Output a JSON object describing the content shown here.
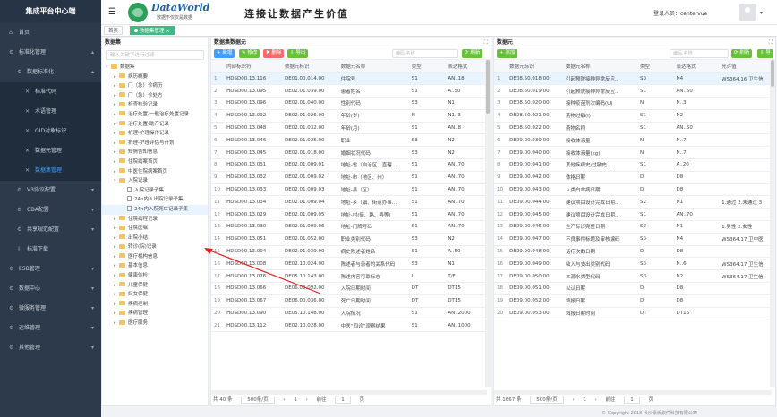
{
  "app": {
    "title": "集成平台中心端",
    "brand": "DataWorld",
    "brand_sub": "数据不仅仅是数据",
    "slogan": "连接让数据产生价值",
    "user_label": "登录人员：centervue"
  },
  "sidebar": {
    "items": [
      {
        "label": "首页",
        "level": 0,
        "icon": "home-icon",
        "arrow": ""
      },
      {
        "label": "标准化管理",
        "level": 0,
        "icon": "gear-icon",
        "arrow": "▴"
      },
      {
        "label": "数据标准化",
        "level": 1,
        "icon": "gear-icon",
        "arrow": "▴"
      },
      {
        "label": "标准代码",
        "level": 2,
        "icon": "wrench-icon",
        "arrow": ""
      },
      {
        "label": "术语管理",
        "level": 2,
        "icon": "wrench-icon",
        "arrow": ""
      },
      {
        "label": "OID对象标识",
        "level": 2,
        "icon": "wrench-icon",
        "arrow": ""
      },
      {
        "label": "数据元管理",
        "level": 2,
        "icon": "wrench-icon",
        "arrow": ""
      },
      {
        "label": "数据集管理",
        "level": 2,
        "icon": "wrench-icon",
        "arrow": "",
        "active": true
      },
      {
        "label": "V3协议配置",
        "level": 1,
        "icon": "gear-icon",
        "arrow": "▾"
      },
      {
        "label": "CDA配置",
        "level": 1,
        "icon": "gear-icon",
        "arrow": "▾"
      },
      {
        "label": "共享规范配置",
        "level": 1,
        "icon": "gear-icon",
        "arrow": "▾"
      },
      {
        "label": "标准下载",
        "level": 1,
        "icon": "download-icon",
        "arrow": ""
      },
      {
        "label": "ESB管理",
        "level": 0,
        "icon": "gear-icon",
        "arrow": "▾"
      },
      {
        "label": "数据中心",
        "level": 0,
        "icon": "gear-icon",
        "arrow": "▾"
      },
      {
        "label": "微服务管理",
        "level": 0,
        "icon": "gear-icon",
        "arrow": "▾"
      },
      {
        "label": "运维管理",
        "level": 0,
        "icon": "gear-icon",
        "arrow": "▾"
      },
      {
        "label": "其他管理",
        "level": 0,
        "icon": "gear-icon",
        "arrow": "▾"
      }
    ]
  },
  "tabs": [
    {
      "label": "首页",
      "active": false
    },
    {
      "label": "数据集管理 ×",
      "active": true
    }
  ],
  "left_panel": {
    "title": "数据集",
    "search_placeholder": "输入关键字进行过滤",
    "tree": [
      {
        "label": "数据集",
        "depth": 0,
        "type": "folder",
        "toggle": "▾"
      },
      {
        "label": "病历概要",
        "depth": 1,
        "type": "folder",
        "toggle": "▸"
      },
      {
        "label": "门（急）诊病历",
        "depth": 1,
        "type": "folder",
        "toggle": "▸"
      },
      {
        "label": "门（急）诊处方",
        "depth": 1,
        "type": "folder",
        "toggle": "▸"
      },
      {
        "label": "检查检验记录",
        "depth": 1,
        "type": "folder",
        "toggle": "▸"
      },
      {
        "label": "治疗处置-一般治疗处置记录",
        "depth": 1,
        "type": "folder",
        "toggle": "▸"
      },
      {
        "label": "治疗处置-助产记录",
        "depth": 1,
        "type": "folder",
        "toggle": "▸"
      },
      {
        "label": "护理-护理操作记录",
        "depth": 1,
        "type": "folder",
        "toggle": "▸"
      },
      {
        "label": "护理-护理评估与计划",
        "depth": 1,
        "type": "folder",
        "toggle": "▸"
      },
      {
        "label": "知情告知信息",
        "depth": 1,
        "type": "folder",
        "toggle": "▸"
      },
      {
        "label": "住院病案首页",
        "depth": 1,
        "type": "folder",
        "toggle": "▸"
      },
      {
        "label": "中医住院病案首页",
        "depth": 1,
        "type": "folder",
        "toggle": "▸"
      },
      {
        "label": "入院记录",
        "depth": 1,
        "type": "folder",
        "toggle": "▾"
      },
      {
        "label": "入院记录子集",
        "depth": 2,
        "type": "file",
        "toggle": ""
      },
      {
        "label": "24h内入出院记录子集",
        "depth": 2,
        "type": "file",
        "toggle": ""
      },
      {
        "label": "24h内入院死亡记录子集",
        "depth": 2,
        "type": "file",
        "toggle": "",
        "selected": true
      },
      {
        "label": "住院病程记录",
        "depth": 1,
        "type": "folder",
        "toggle": "▸"
      },
      {
        "label": "住院医嘱",
        "depth": 1,
        "type": "folder",
        "toggle": "▸"
      },
      {
        "label": "出院小结",
        "depth": 1,
        "type": "folder",
        "toggle": "▸"
      },
      {
        "label": "转诊(院)记录",
        "depth": 1,
        "type": "folder",
        "toggle": "▸"
      },
      {
        "label": "医疗机构信息",
        "depth": 1,
        "type": "folder",
        "toggle": "▸"
      },
      {
        "label": "基本信息",
        "depth": 1,
        "type": "folder",
        "toggle": "▸"
      },
      {
        "label": "健康体检",
        "depth": 1,
        "type": "folder",
        "toggle": "▸"
      },
      {
        "label": "儿童保健",
        "depth": 1,
        "type": "folder",
        "toggle": "▸"
      },
      {
        "label": "妇女保健",
        "depth": 1,
        "type": "folder",
        "toggle": "▸"
      },
      {
        "label": "疾病控制",
        "depth": 1,
        "type": "folder",
        "toggle": "▸"
      },
      {
        "label": "疾病管理",
        "depth": 1,
        "type": "folder",
        "toggle": "▸"
      },
      {
        "label": "医疗服务",
        "depth": 1,
        "type": "folder",
        "toggle": "▸"
      }
    ]
  },
  "mid_panel": {
    "title": "数据集数据元",
    "buttons": {
      "add": "+ 新增",
      "edit": "✎ 修改",
      "delete": "✖ 删除",
      "export": "⇩ 导出",
      "refresh": "⟳ 刷新"
    },
    "search_placeholder": "编码,名称",
    "columns": [
      "",
      "内部标识符",
      "数据元标识",
      "数据元名称",
      "类型",
      "表达格式"
    ],
    "rows": [
      [
        "1",
        "HDSD00.13.116",
        "DE01.00.014.00",
        "住院号",
        "S1",
        "AN..18"
      ],
      [
        "2",
        "HDSD00.13.095",
        "DE02.01.039.00",
        "患者姓名",
        "S1",
        "A..50"
      ],
      [
        "3",
        "HDSD00.13.096",
        "DE02.01.040.00",
        "性别代码",
        "S3",
        "N1"
      ],
      [
        "4",
        "HDSD00.13.092",
        "DE02.01.026.00",
        "年龄(岁)",
        "N",
        "N1..3"
      ],
      [
        "5",
        "HDSD00.13.048",
        "DE02.01.032.00",
        "年龄(月)",
        "S1",
        "AN..8"
      ],
      [
        "6",
        "HDSD00.13.046",
        "DE02.01.025.00",
        "职业",
        "S3",
        "N2"
      ],
      [
        "7",
        "HDSD00.13.045",
        "DE02.01.018.00",
        "婚姻状况代码",
        "S3",
        "N2"
      ],
      [
        "8",
        "HDSD00.13.031",
        "DE02.01.009.01",
        "地址-省（自治区、直辖…",
        "S1",
        "AN..70"
      ],
      [
        "9",
        "HDSD00.13.032",
        "DE02.01.009.02",
        "地址-市（地区、州）",
        "S1",
        "AN..70"
      ],
      [
        "10",
        "HDSD00.13.033",
        "DE02.01.009.03",
        "地址-县（区）",
        "S1",
        "AN..70"
      ],
      [
        "11",
        "HDSD00.13.034",
        "DE02.01.009.04",
        "地址-乡（镇、街道办事…",
        "S1",
        "AN..70"
      ],
      [
        "12",
        "HDSD00.13.029",
        "DE02.01.009.05",
        "地址-村(街、路、弄等)",
        "S1",
        "AN..70"
      ],
      [
        "13",
        "HDSD00.13.030",
        "DE02.01.009.06",
        "地址-门牌号码",
        "S1",
        "AN..70"
      ],
      [
        "14",
        "HDSD00.13.051",
        "DE02.01.052.00",
        "职业类别代码",
        "S3",
        "N2"
      ],
      [
        "15",
        "HDSD00.13.004",
        "DE02.01.039.00",
        "病史陈述者姓名",
        "S1",
        "A..50"
      ],
      [
        "16",
        "HDSD00.13.008",
        "DE02.10.024.00",
        "陈述者与患者的关系代码",
        "S3",
        "N1"
      ],
      [
        "17",
        "HDSD00.13.076",
        "DE05.10.143.00",
        "陈述内容可靠标志",
        "L",
        "T/F"
      ],
      [
        "18",
        "HDSD00.13.066",
        "DE06.00.092.00",
        "入院日期时间",
        "DT",
        "DT15"
      ],
      [
        "19",
        "HDSD00.13.067",
        "DE06.00.036.00",
        "死亡日期时间",
        "DT",
        "DT15"
      ],
      [
        "20",
        "HDSD00.13.090",
        "DE05.10.148.00",
        "入院情况",
        "S1",
        "AN..2000"
      ],
      [
        "21",
        "HDSD00.13.112",
        "DE02.10.028.00",
        "中医“四诊”观察结果",
        "S1",
        "AN..1000"
      ]
    ],
    "pager": {
      "total": "共 40 条",
      "size": "500条/页",
      "prev": "‹",
      "next": "›",
      "goto": "前往",
      "page": "1",
      "page_suffix": "页"
    }
  },
  "right_panel": {
    "title": "数据元",
    "buttons": {
      "add": "+ 添加",
      "refresh": "⟳ 刷新",
      "export": "⇩ 导"
    },
    "search_placeholder": "编码,名称",
    "columns": [
      "",
      "数据元标识",
      "数据元名称",
      "类型",
      "表达格式",
      "允许值"
    ],
    "rows": [
      [
        "1",
        "DE08.50.018.00",
        "引起预防接种异常反应…",
        "S3",
        "N4",
        "WS364.16 卫生信"
      ],
      [
        "2",
        "DE08.50.019.00",
        "引起预防接种异常反应…",
        "S1",
        "AN..50",
        ""
      ],
      [
        "3",
        "DE08.50.020.00",
        "接种疫苗剂次编码(U)",
        "N",
        "N..3",
        ""
      ],
      [
        "4",
        "DE08.50.021.00",
        "药物过敏(I)",
        "S1",
        "N2",
        ""
      ],
      [
        "5",
        "DE08.50.022.00",
        "药物名称",
        "S1",
        "AN..50",
        ""
      ],
      [
        "6",
        "DE09.00.039.00",
        "接收体液量",
        "N",
        "N..7",
        ""
      ],
      [
        "7",
        "DE09.00.040.00",
        "接收体液量(kg)",
        "N",
        "N..7",
        ""
      ],
      [
        "8",
        "DE09.00.041.00",
        "其他疾病史/过敏史…",
        "S1",
        "A..20",
        ""
      ],
      [
        "9",
        "DE09.00.042.00",
        "体格日期",
        "D",
        "D8",
        ""
      ],
      [
        "10",
        "DE09.00.043.00",
        "人类白血病日期",
        "D",
        "D8",
        ""
      ],
      [
        "11",
        "DE09.00.044.00",
        "建议项目设计完成日期…",
        "S2",
        "N1",
        "1.通过 2.未通过 3"
      ],
      [
        "12",
        "DE09.00.045.00",
        "建议项目设计完成日期…",
        "S1",
        "AN..70",
        ""
      ],
      [
        "13",
        "DE09.00.046.00",
        "生产标识完整日期",
        "S3",
        "N1",
        "1.男性 2.女性"
      ],
      [
        "14",
        "DE09.00.047.00",
        "不良事件标题及审核编码",
        "S3",
        "N4",
        "WS364.17 卫中医"
      ],
      [
        "15",
        "DE09.00.048.00",
        "话疗次数日期",
        "D",
        "D8",
        ""
      ],
      [
        "16",
        "DE09.00.049.00",
        "收入与支出类别代码",
        "S3",
        "N..6",
        "WS364.17 卫生信"
      ],
      [
        "17",
        "DE09.00.050.00",
        "本源水类型代码",
        "S3",
        "N2",
        "WS364.17 卫生信"
      ],
      [
        "18",
        "DE09.00.051.00",
        "以认日期",
        "D",
        "D8",
        ""
      ],
      [
        "19",
        "DE09.00.052.00",
        "填报日期",
        "D",
        "D8",
        ""
      ],
      [
        "20",
        "DE09.00.053.00",
        "填报日期时间",
        "DT",
        "DT15",
        ""
      ]
    ],
    "pager": {
      "total": "共 1667 条",
      "size": "500条/页",
      "prev": "‹",
      "next": "›",
      "goto": "前往",
      "page": "1",
      "page_suffix": "页"
    }
  },
  "footer": {
    "copyright": "© Copyright 2018 长沙豪氏软件科技有限公司"
  }
}
